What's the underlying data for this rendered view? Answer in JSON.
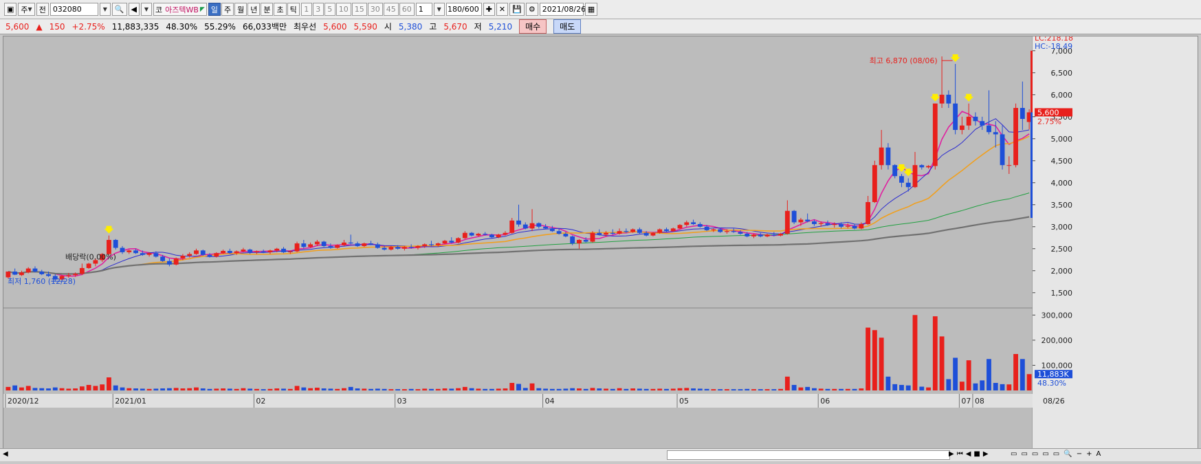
{
  "toolbar": {
    "market_prefix": "주",
    "jeon": "전",
    "code": "032080",
    "ko_prefix": "코",
    "stock_name": "아즈텍WB",
    "periods": [
      "일",
      "주",
      "월",
      "년",
      "분",
      "초",
      "틱"
    ],
    "selected_period": "일",
    "intervals": [
      "1",
      "3",
      "5",
      "10",
      "15",
      "30",
      "45",
      "60"
    ],
    "multiplier": "1",
    "count": "180/600",
    "date": "2021/08/26"
  },
  "quote": {
    "price": "5,600",
    "change": "150",
    "change_pct": "+2.75%",
    "volume": "11,883,335",
    "ratio1": "48.30%",
    "ratio2": "55.29%",
    "amount": "66,033백만",
    "best_label": "최우선",
    "ask": "5,600",
    "bid": "5,590",
    "open_label": "시",
    "open": "5,380",
    "high_label": "고",
    "high": "5,670",
    "low_label": "저",
    "low": "5,210",
    "buy_label": "매수",
    "sell_label": "매도"
  },
  "chart_data": {
    "type": "candlestick",
    "price_axis": {
      "ticks": [
        "7,000",
        "6,500",
        "6,000",
        "5,500",
        "5,000",
        "4,500",
        "4,000",
        "3,500",
        "3,000",
        "2,500",
        "2,000",
        "1,500"
      ],
      "range": [
        1200,
        7200
      ]
    },
    "volume_axis": {
      "ticks": [
        "300,000",
        "200,000",
        "100,000"
      ],
      "range": [
        0,
        320000
      ]
    },
    "x_labels": [
      "2020/12",
      "2021/01",
      "02",
      "03",
      "04",
      "05",
      "06",
      "07",
      "08",
      "08/26"
    ],
    "annotations": {
      "high": "최고 6,870 (08/06)",
      "low": "최저 1,760 (12/28)",
      "dividend": "배당락(0.00%)",
      "lc": "LC:218.18",
      "hc": "HC:-18.49",
      "current_price": "5,600",
      "current_pct": "2.75%",
      "current_volume": "11,883K",
      "current_volume_pct": "48.30%"
    },
    "colors": {
      "up": "#e8201c",
      "down": "#1e4fd8",
      "ma5": "#e020a0",
      "ma10": "#2a2ad0",
      "ma20": "#f0a020",
      "ma60": "#20a040",
      "ma120": "#707070",
      "marker": "#ffee00"
    },
    "candles": [
      {
        "o": 1850,
        "h": 1980,
        "l": 1820,
        "c": 1980,
        "v": 14000
      },
      {
        "o": 1980,
        "h": 2050,
        "l": 1900,
        "c": 1910,
        "v": 20000
      },
      {
        "o": 1900,
        "h": 2000,
        "l": 1880,
        "c": 1960,
        "v": 12000
      },
      {
        "o": 1960,
        "h": 2080,
        "l": 1940,
        "c": 2050,
        "v": 18000
      },
      {
        "o": 2050,
        "h": 2100,
        "l": 1960,
        "c": 1980,
        "v": 10000
      },
      {
        "o": 1980,
        "h": 2020,
        "l": 1900,
        "c": 1920,
        "v": 9000
      },
      {
        "o": 1920,
        "h": 1980,
        "l": 1860,
        "c": 1880,
        "v": 8000
      },
      {
        "o": 1880,
        "h": 1920,
        "l": 1760,
        "c": 1800,
        "v": 12000
      },
      {
        "o": 1800,
        "h": 1900,
        "l": 1780,
        "c": 1880,
        "v": 9000
      },
      {
        "o": 1880,
        "h": 1950,
        "l": 1840,
        "c": 1900,
        "v": 7000
      },
      {
        "o": 1900,
        "h": 1960,
        "l": 1860,
        "c": 1930,
        "v": 8000
      },
      {
        "o": 1930,
        "h": 2080,
        "l": 1920,
        "c": 2060,
        "v": 16000
      },
      {
        "o": 2060,
        "h": 2180,
        "l": 2040,
        "c": 2160,
        "v": 22000
      },
      {
        "o": 2160,
        "h": 2280,
        "l": 2100,
        "c": 2240,
        "v": 18000
      },
      {
        "o": 2240,
        "h": 2400,
        "l": 2200,
        "c": 2380,
        "v": 24000
      },
      {
        "o": 2380,
        "h": 2800,
        "l": 2360,
        "c": 2700,
        "v": 52000
      },
      {
        "o": 2700,
        "h": 2720,
        "l": 2480,
        "c": 2520,
        "v": 20000
      },
      {
        "o": 2520,
        "h": 2560,
        "l": 2380,
        "c": 2420,
        "v": 12000
      },
      {
        "o": 2420,
        "h": 2480,
        "l": 2380,
        "c": 2460,
        "v": 9000
      },
      {
        "o": 2460,
        "h": 2500,
        "l": 2380,
        "c": 2400,
        "v": 8000
      },
      {
        "o": 2400,
        "h": 2460,
        "l": 2340,
        "c": 2360,
        "v": 7000
      },
      {
        "o": 2360,
        "h": 2420,
        "l": 2320,
        "c": 2400,
        "v": 6000
      },
      {
        "o": 2400,
        "h": 2440,
        "l": 2300,
        "c": 2320,
        "v": 7000
      },
      {
        "o": 2320,
        "h": 2360,
        "l": 2200,
        "c": 2220,
        "v": 8000
      },
      {
        "o": 2220,
        "h": 2280,
        "l": 2100,
        "c": 2140,
        "v": 9000
      },
      {
        "o": 2140,
        "h": 2300,
        "l": 2120,
        "c": 2280,
        "v": 10000
      },
      {
        "o": 2280,
        "h": 2380,
        "l": 2240,
        "c": 2340,
        "v": 8000
      },
      {
        "o": 2340,
        "h": 2420,
        "l": 2300,
        "c": 2380,
        "v": 9000
      },
      {
        "o": 2380,
        "h": 2500,
        "l": 2360,
        "c": 2460,
        "v": 12000
      },
      {
        "o": 2460,
        "h": 2480,
        "l": 2340,
        "c": 2360,
        "v": 8000
      },
      {
        "o": 2360,
        "h": 2400,
        "l": 2300,
        "c": 2320,
        "v": 6000
      },
      {
        "o": 2320,
        "h": 2420,
        "l": 2300,
        "c": 2400,
        "v": 7000
      },
      {
        "o": 2400,
        "h": 2480,
        "l": 2380,
        "c": 2450,
        "v": 8000
      },
      {
        "o": 2450,
        "h": 2500,
        "l": 2380,
        "c": 2400,
        "v": 7000
      },
      {
        "o": 2400,
        "h": 2460,
        "l": 2360,
        "c": 2440,
        "v": 6000
      },
      {
        "o": 2440,
        "h": 2520,
        "l": 2420,
        "c": 2480,
        "v": 9000
      },
      {
        "o": 2480,
        "h": 2500,
        "l": 2380,
        "c": 2420,
        "v": 7000
      },
      {
        "o": 2420,
        "h": 2460,
        "l": 2380,
        "c": 2440,
        "v": 6000
      },
      {
        "o": 2440,
        "h": 2480,
        "l": 2400,
        "c": 2420,
        "v": 5000
      },
      {
        "o": 2420,
        "h": 2480,
        "l": 2380,
        "c": 2460,
        "v": 6000
      },
      {
        "o": 2460,
        "h": 2520,
        "l": 2420,
        "c": 2500,
        "v": 8000
      },
      {
        "o": 2500,
        "h": 2540,
        "l": 2400,
        "c": 2420,
        "v": 7000
      },
      {
        "o": 2420,
        "h": 2460,
        "l": 2380,
        "c": 2440,
        "v": 6000
      },
      {
        "o": 2440,
        "h": 2660,
        "l": 2420,
        "c": 2620,
        "v": 18000
      },
      {
        "o": 2620,
        "h": 2700,
        "l": 2500,
        "c": 2540,
        "v": 12000
      },
      {
        "o": 2540,
        "h": 2640,
        "l": 2520,
        "c": 2600,
        "v": 9000
      },
      {
        "o": 2600,
        "h": 2700,
        "l": 2560,
        "c": 2660,
        "v": 11000
      },
      {
        "o": 2660,
        "h": 2680,
        "l": 2540,
        "c": 2560,
        "v": 8000
      },
      {
        "o": 2560,
        "h": 2620,
        "l": 2500,
        "c": 2520,
        "v": 7000
      },
      {
        "o": 2520,
        "h": 2600,
        "l": 2500,
        "c": 2580,
        "v": 6000
      },
      {
        "o": 2580,
        "h": 2700,
        "l": 2560,
        "c": 2640,
        "v": 9000
      },
      {
        "o": 2640,
        "h": 2820,
        "l": 2600,
        "c": 2620,
        "v": 14000
      },
      {
        "o": 2620,
        "h": 2660,
        "l": 2540,
        "c": 2560,
        "v": 8000
      },
      {
        "o": 2560,
        "h": 2640,
        "l": 2540,
        "c": 2620,
        "v": 7000
      },
      {
        "o": 2620,
        "h": 2680,
        "l": 2580,
        "c": 2600,
        "v": 6000
      },
      {
        "o": 2600,
        "h": 2640,
        "l": 2500,
        "c": 2520,
        "v": 7000
      },
      {
        "o": 2520,
        "h": 2560,
        "l": 2460,
        "c": 2480,
        "v": 6000
      },
      {
        "o": 2480,
        "h": 2560,
        "l": 2460,
        "c": 2540,
        "v": 5000
      },
      {
        "o": 2540,
        "h": 2580,
        "l": 2480,
        "c": 2500,
        "v": 5000
      },
      {
        "o": 2500,
        "h": 2560,
        "l": 2460,
        "c": 2540,
        "v": 5000
      },
      {
        "o": 2540,
        "h": 2600,
        "l": 2500,
        "c": 2520,
        "v": 6000
      },
      {
        "o": 2520,
        "h": 2580,
        "l": 2480,
        "c": 2560,
        "v": 5000
      },
      {
        "o": 2560,
        "h": 2620,
        "l": 2520,
        "c": 2600,
        "v": 7000
      },
      {
        "o": 2600,
        "h": 2680,
        "l": 2560,
        "c": 2580,
        "v": 6000
      },
      {
        "o": 2580,
        "h": 2640,
        "l": 2540,
        "c": 2620,
        "v": 6000
      },
      {
        "o": 2620,
        "h": 2700,
        "l": 2600,
        "c": 2680,
        "v": 8000
      },
      {
        "o": 2680,
        "h": 2760,
        "l": 2620,
        "c": 2640,
        "v": 7000
      },
      {
        "o": 2640,
        "h": 2760,
        "l": 2620,
        "c": 2740,
        "v": 9000
      },
      {
        "o": 2740,
        "h": 2900,
        "l": 2720,
        "c": 2860,
        "v": 14000
      },
      {
        "o": 2860,
        "h": 2880,
        "l": 2780,
        "c": 2800,
        "v": 9000
      },
      {
        "o": 2800,
        "h": 2860,
        "l": 2780,
        "c": 2840,
        "v": 7000
      },
      {
        "o": 2840,
        "h": 2880,
        "l": 2800,
        "c": 2820,
        "v": 6000
      },
      {
        "o": 2820,
        "h": 2840,
        "l": 2740,
        "c": 2760,
        "v": 6000
      },
      {
        "o": 2760,
        "h": 2840,
        "l": 2740,
        "c": 2820,
        "v": 7000
      },
      {
        "o": 2820,
        "h": 2900,
        "l": 2800,
        "c": 2860,
        "v": 8000
      },
      {
        "o": 2860,
        "h": 3200,
        "l": 2840,
        "c": 3140,
        "v": 30000
      },
      {
        "o": 3140,
        "h": 3500,
        "l": 3000,
        "c": 3050,
        "v": 26000
      },
      {
        "o": 3050,
        "h": 3100,
        "l": 2940,
        "c": 2960,
        "v": 10000
      },
      {
        "o": 2960,
        "h": 3400,
        "l": 2900,
        "c": 3080,
        "v": 28000
      },
      {
        "o": 3080,
        "h": 3100,
        "l": 2960,
        "c": 3000,
        "v": 9000
      },
      {
        "o": 3000,
        "h": 3060,
        "l": 2940,
        "c": 2960,
        "v": 7000
      },
      {
        "o": 2960,
        "h": 3020,
        "l": 2880,
        "c": 2900,
        "v": 6000
      },
      {
        "o": 2900,
        "h": 2960,
        "l": 2820,
        "c": 2840,
        "v": 6000
      },
      {
        "o": 2840,
        "h": 2880,
        "l": 2760,
        "c": 2780,
        "v": 7000
      },
      {
        "o": 2780,
        "h": 2800,
        "l": 2580,
        "c": 2620,
        "v": 9000
      },
      {
        "o": 2620,
        "h": 2720,
        "l": 2500,
        "c": 2700,
        "v": 8000
      },
      {
        "o": 2700,
        "h": 2760,
        "l": 2640,
        "c": 2660,
        "v": 6000
      },
      {
        "o": 2660,
        "h": 2900,
        "l": 2640,
        "c": 2860,
        "v": 10000
      },
      {
        "o": 2860,
        "h": 2940,
        "l": 2800,
        "c": 2820,
        "v": 8000
      },
      {
        "o": 2820,
        "h": 2900,
        "l": 2780,
        "c": 2860,
        "v": 7000
      },
      {
        "o": 2860,
        "h": 2940,
        "l": 2820,
        "c": 2840,
        "v": 6000
      },
      {
        "o": 2840,
        "h": 2960,
        "l": 2820,
        "c": 2900,
        "v": 9000
      },
      {
        "o": 2900,
        "h": 2960,
        "l": 2860,
        "c": 2880,
        "v": 6000
      },
      {
        "o": 2880,
        "h": 2960,
        "l": 2860,
        "c": 2940,
        "v": 8000
      },
      {
        "o": 2940,
        "h": 2980,
        "l": 2840,
        "c": 2860,
        "v": 7000
      },
      {
        "o": 2860,
        "h": 2900,
        "l": 2780,
        "c": 2800,
        "v": 6000
      },
      {
        "o": 2800,
        "h": 2880,
        "l": 2780,
        "c": 2860,
        "v": 6000
      },
      {
        "o": 2860,
        "h": 2960,
        "l": 2840,
        "c": 2940,
        "v": 7000
      },
      {
        "o": 2940,
        "h": 2980,
        "l": 2880,
        "c": 2900,
        "v": 6000
      },
      {
        "o": 2900,
        "h": 2980,
        "l": 2880,
        "c": 2960,
        "v": 7000
      },
      {
        "o": 2960,
        "h": 3060,
        "l": 2940,
        "c": 3040,
        "v": 9000
      },
      {
        "o": 3040,
        "h": 3140,
        "l": 3000,
        "c": 3100,
        "v": 10000
      },
      {
        "o": 3100,
        "h": 3160,
        "l": 3040,
        "c": 3060,
        "v": 8000
      },
      {
        "o": 3060,
        "h": 3100,
        "l": 2980,
        "c": 3000,
        "v": 7000
      },
      {
        "o": 3000,
        "h": 3040,
        "l": 2900,
        "c": 2920,
        "v": 6000
      },
      {
        "o": 2920,
        "h": 2960,
        "l": 2880,
        "c": 2940,
        "v": 5000
      },
      {
        "o": 2940,
        "h": 2980,
        "l": 2860,
        "c": 2880,
        "v": 5000
      },
      {
        "o": 2880,
        "h": 2940,
        "l": 2840,
        "c": 2900,
        "v": 5000
      },
      {
        "o": 2900,
        "h": 2960,
        "l": 2860,
        "c": 2880,
        "v": 5000
      },
      {
        "o": 2880,
        "h": 2920,
        "l": 2820,
        "c": 2840,
        "v": 5000
      },
      {
        "o": 2840,
        "h": 2880,
        "l": 2760,
        "c": 2780,
        "v": 6000
      },
      {
        "o": 2780,
        "h": 2840,
        "l": 2740,
        "c": 2820,
        "v": 5000
      },
      {
        "o": 2820,
        "h": 2860,
        "l": 2760,
        "c": 2780,
        "v": 5000
      },
      {
        "o": 2780,
        "h": 2840,
        "l": 2760,
        "c": 2820,
        "v": 5000
      },
      {
        "o": 2820,
        "h": 2880,
        "l": 2780,
        "c": 2800,
        "v": 5000
      },
      {
        "o": 2800,
        "h": 2860,
        "l": 2780,
        "c": 2840,
        "v": 6000
      },
      {
        "o": 2840,
        "h": 3600,
        "l": 2820,
        "c": 3360,
        "v": 55000
      },
      {
        "o": 3360,
        "h": 3380,
        "l": 3060,
        "c": 3100,
        "v": 22000
      },
      {
        "o": 3100,
        "h": 3200,
        "l": 3020,
        "c": 3160,
        "v": 12000
      },
      {
        "o": 3160,
        "h": 3300,
        "l": 3100,
        "c": 3120,
        "v": 14000
      },
      {
        "o": 3120,
        "h": 3160,
        "l": 3020,
        "c": 3060,
        "v": 9000
      },
      {
        "o": 3060,
        "h": 3120,
        "l": 3000,
        "c": 3080,
        "v": 7000
      },
      {
        "o": 3080,
        "h": 3140,
        "l": 3020,
        "c": 3040,
        "v": 6000
      },
      {
        "o": 3040,
        "h": 3100,
        "l": 2980,
        "c": 3060,
        "v": 6000
      },
      {
        "o": 3060,
        "h": 3100,
        "l": 2960,
        "c": 3000,
        "v": 6000
      },
      {
        "o": 3000,
        "h": 3080,
        "l": 2960,
        "c": 3020,
        "v": 6000
      },
      {
        "o": 3020,
        "h": 3060,
        "l": 2940,
        "c": 2960,
        "v": 6000
      },
      {
        "o": 2960,
        "h": 3100,
        "l": 2940,
        "c": 3060,
        "v": 8000
      },
      {
        "o": 3060,
        "h": 3700,
        "l": 3040,
        "c": 3560,
        "v": 250000
      },
      {
        "o": 3560,
        "h": 4500,
        "l": 3540,
        "c": 4400,
        "v": 240000
      },
      {
        "o": 4400,
        "h": 5200,
        "l": 4300,
        "c": 4800,
        "v": 210000
      },
      {
        "o": 4800,
        "h": 4900,
        "l": 4300,
        "c": 4400,
        "v": 55000
      },
      {
        "o": 4400,
        "h": 4420,
        "l": 4100,
        "c": 4150,
        "v": 25000
      },
      {
        "o": 4150,
        "h": 4200,
        "l": 3900,
        "c": 4000,
        "v": 22000
      },
      {
        "o": 4000,
        "h": 4100,
        "l": 3800,
        "c": 3900,
        "v": 20000
      },
      {
        "o": 3900,
        "h": 4700,
        "l": 3880,
        "c": 4400,
        "v": 300000
      },
      {
        "o": 4400,
        "h": 4420,
        "l": 4300,
        "c": 4350,
        "v": 15000
      },
      {
        "o": 4350,
        "h": 4400,
        "l": 4320,
        "c": 4380,
        "v": 12000
      },
      {
        "o": 4380,
        "h": 5800,
        "l": 4300,
        "c": 5800,
        "v": 295000
      },
      {
        "o": 5800,
        "h": 6870,
        "l": 5700,
        "c": 6000,
        "v": 215000
      },
      {
        "o": 6000,
        "h": 6100,
        "l": 5700,
        "c": 5800,
        "v": 45000
      },
      {
        "o": 5800,
        "h": 6700,
        "l": 5100,
        "c": 5200,
        "v": 130000
      },
      {
        "o": 5200,
        "h": 5500,
        "l": 5100,
        "c": 5300,
        "v": 35000
      },
      {
        "o": 5300,
        "h": 5800,
        "l": 5200,
        "c": 5500,
        "v": 120000
      },
      {
        "o": 5500,
        "h": 5600,
        "l": 5300,
        "c": 5400,
        "v": 28000
      },
      {
        "o": 5400,
        "h": 5500,
        "l": 5200,
        "c": 5300,
        "v": 40000
      },
      {
        "o": 5300,
        "h": 6100,
        "l": 5100,
        "c": 5150,
        "v": 125000
      },
      {
        "o": 5150,
        "h": 5400,
        "l": 4800,
        "c": 5100,
        "v": 30000
      },
      {
        "o": 5100,
        "h": 5300,
        "l": 4300,
        "c": 4400,
        "v": 25000
      },
      {
        "o": 4400,
        "h": 4600,
        "l": 4200,
        "c": 4400,
        "v": 24000
      },
      {
        "o": 4400,
        "h": 5800,
        "l": 4350,
        "c": 5700,
        "v": 145000
      },
      {
        "o": 5700,
        "h": 6300,
        "l": 5200,
        "c": 5450,
        "v": 125000
      },
      {
        "o": 5380,
        "h": 5670,
        "l": 5210,
        "c": 5600,
        "v": 65000
      }
    ]
  }
}
